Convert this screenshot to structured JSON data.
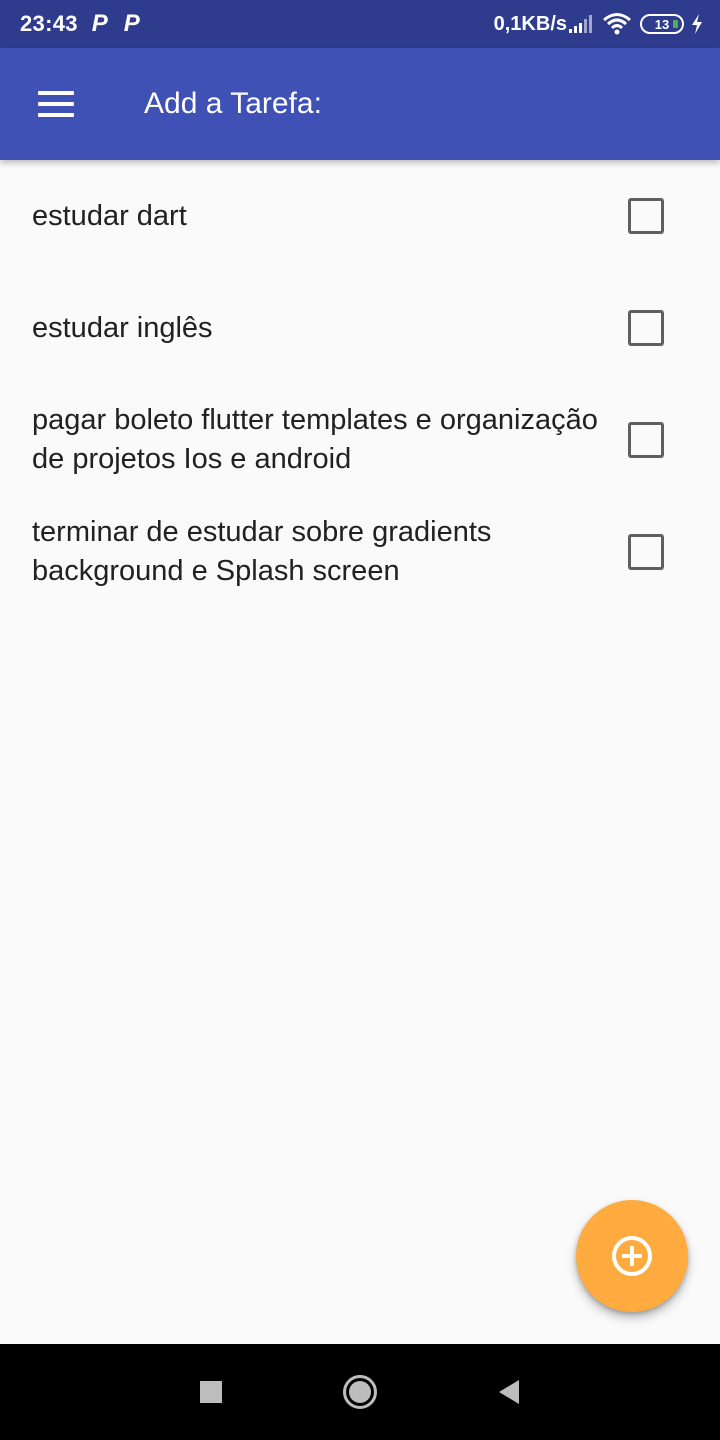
{
  "status_bar": {
    "time": "23:43",
    "notification_icons": [
      "P",
      "P"
    ],
    "network_speed": "0,1KB/s",
    "battery_level": "13",
    "icons": [
      "signal-icon",
      "wifi-icon",
      "battery-icon",
      "charging-bolt-icon"
    ]
  },
  "app_bar": {
    "title": "Add a Tarefa:",
    "menu_icon": "menu-icon",
    "background_color": "#3f51b5"
  },
  "tasks": [
    {
      "label": "estudar dart",
      "checked": false
    },
    {
      "label": "estudar inglês",
      "checked": false
    },
    {
      "label": "pagar boleto flutter templates e organização de projetos Ios e android",
      "checked": false
    },
    {
      "label": "terminar de estudar sobre gradients background e Splash screen",
      "checked": false
    }
  ],
  "fab": {
    "icon": "add-circle-icon",
    "color": "#ffab40"
  },
  "nav_bar": {
    "buttons": [
      "recents-icon",
      "home-icon",
      "back-icon"
    ]
  }
}
